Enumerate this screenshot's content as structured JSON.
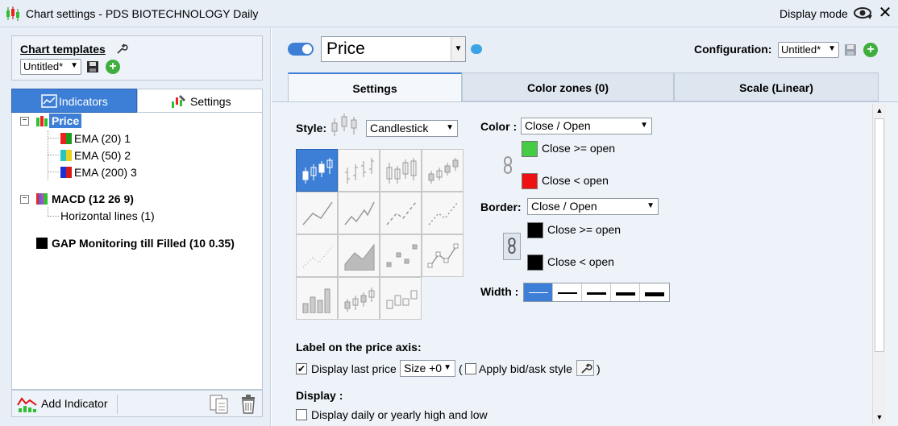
{
  "window": {
    "title": "Chart settings - PDS BIOTECHNOLOGY Daily",
    "display_mode_label": "Display mode",
    "close_glyph": "✕"
  },
  "left": {
    "templates_title": "Chart templates",
    "template_value": "Untitled*",
    "tabs": {
      "indicators": "Indicators",
      "settings": "Settings"
    },
    "tree": {
      "price": "Price",
      "ema1": "EMA (20) 1",
      "ema2": "EMA (50) 2",
      "ema3": "EMA (200) 3",
      "macd": "MACD (12 26 9)",
      "hlines": "Horizontal lines (1)",
      "gap": "GAP Monitoring till Filled (10 0.35)"
    },
    "add_indicator": "Add Indicator"
  },
  "right": {
    "indicator_name": "Price",
    "configuration_label": "Configuration:",
    "configuration_value": "Untitled*",
    "tabs": {
      "settings": "Settings",
      "color_zones": "Color zones (0)",
      "scale": "Scale (Linear)"
    },
    "style_label": "Style:",
    "style_value": "Candlestick",
    "color_label": "Color :",
    "color_value": "Close / Open",
    "color_up_label": "Close >= open",
    "color_down_label": "Close < open",
    "border_label": "Border:",
    "border_value": "Close / Open",
    "border_up_label": "Close >= open",
    "border_down_label": "Close < open",
    "width_label": "Width :",
    "price_axis_heading": "Label on the price axis:",
    "display_last_price": "Display last price",
    "size_value": "Size +0",
    "paren_open": "(",
    "apply_bidask": "Apply bid/ask style",
    "paren_close": ")",
    "display_heading": "Display :",
    "display_highlow": "Display daily or yearly high and low"
  },
  "colors": {
    "accent": "#3d7fd6",
    "up_fill": "#44cc44",
    "down_fill": "#ee1111",
    "border_up": "#000000",
    "border_down": "#000000"
  },
  "icons": [
    "candles-icon",
    "eye-icon",
    "close-icon",
    "wrench-icon",
    "save-icon",
    "add-icon",
    "chart-icon",
    "settings-icon",
    "chat-icon",
    "copy-icon",
    "trash-icon",
    "link-icon"
  ]
}
